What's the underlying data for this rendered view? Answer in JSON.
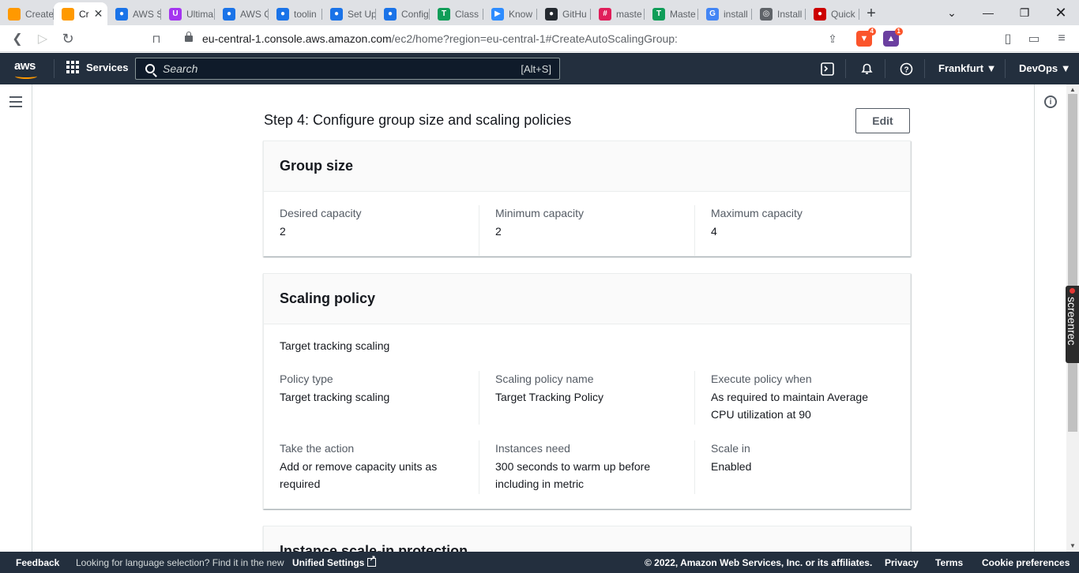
{
  "browser": {
    "tabs": [
      {
        "label": "Create",
        "icon": "aws-box-icon",
        "color": "#ff9900",
        "glyph": ""
      },
      {
        "label": "Cr",
        "icon": "aws-box-icon",
        "color": "#ff9900",
        "glyph": "",
        "active": true
      },
      {
        "label": "AWS S",
        "icon": "swirl-icon",
        "color": "#1a73e8",
        "glyph": "●"
      },
      {
        "label": "Ultima",
        "icon": "udemy-icon",
        "color": "#a435f0",
        "glyph": "U"
      },
      {
        "label": "AWS C",
        "icon": "swirl-icon",
        "color": "#1a73e8",
        "glyph": "●"
      },
      {
        "label": "toolin",
        "icon": "swirl-icon",
        "color": "#1a73e8",
        "glyph": "●"
      },
      {
        "label": "Set Up",
        "icon": "swirl-icon",
        "color": "#1a73e8",
        "glyph": "●"
      },
      {
        "label": "Config",
        "icon": "swirl-icon",
        "color": "#1a73e8",
        "glyph": "●"
      },
      {
        "label": "Class",
        "icon": "sheets-icon",
        "color": "#0f9d58",
        "glyph": "T"
      },
      {
        "label": "Know",
        "icon": "zoom-icon",
        "color": "#2d8cff",
        "glyph": "▶"
      },
      {
        "label": "GitHu",
        "icon": "github-icon",
        "color": "#24292f",
        "glyph": "●"
      },
      {
        "label": "maste",
        "icon": "slack-icon",
        "color": "#e01e5a",
        "glyph": "#"
      },
      {
        "label": "Maste",
        "icon": "sheets-icon",
        "color": "#0f9d58",
        "glyph": "T"
      },
      {
        "label": "install",
        "icon": "google-icon",
        "color": "#4285f4",
        "glyph": "G"
      },
      {
        "label": "Install",
        "icon": "ubuntu-icon",
        "color": "#5f6368",
        "glyph": "◎"
      },
      {
        "label": "Quick",
        "icon": "redhat-icon",
        "color": "#cc0000",
        "glyph": "●"
      }
    ],
    "url_host": "eu-central-1.console.aws.amazon.com",
    "url_path": "/ec2/home?region=eu-central-1#CreateAutoScalingGroup:",
    "brave_badge": "4",
    "alert_badge": "1"
  },
  "aws_nav": {
    "logo": "aws",
    "services_label": "Services",
    "search_placeholder": "Search",
    "search_shortcut": "[Alt+S]",
    "region": "Frankfurt ▼",
    "account": "DevOps ▼"
  },
  "screenrec": {
    "label": "screenrec"
  },
  "step": {
    "title": "Step 4: Configure group size and scaling policies",
    "edit_label": "Edit"
  },
  "group_size": {
    "heading": "Group size",
    "items": [
      {
        "label": "Desired capacity",
        "value": "2"
      },
      {
        "label": "Minimum capacity",
        "value": "2"
      },
      {
        "label": "Maximum capacity",
        "value": "4"
      }
    ]
  },
  "scaling_policy": {
    "heading": "Scaling policy",
    "subtitle": "Target tracking scaling",
    "row1": [
      {
        "label": "Policy type",
        "value": "Target tracking scaling"
      },
      {
        "label": "Scaling policy name",
        "value": "Target Tracking Policy"
      },
      {
        "label": "Execute policy when",
        "value": "As required to maintain Average CPU utilization at 90"
      }
    ],
    "row2": [
      {
        "label": "Take the action",
        "value": "Add or remove capacity units as required"
      },
      {
        "label": "Instances need",
        "value": "300 seconds to warm up before including in metric"
      },
      {
        "label": "Scale in",
        "value": "Enabled"
      }
    ]
  },
  "scale_in_protection": {
    "heading": "Instance scale-in protection"
  },
  "footer": {
    "feedback": "Feedback",
    "language_prompt": "Looking for language selection? Find it in the new",
    "unified_settings": "Unified Settings",
    "copyright": "© 2022, Amazon Web Services, Inc. or its affiliates.",
    "privacy": "Privacy",
    "terms": "Terms",
    "cookies": "Cookie preferences"
  }
}
